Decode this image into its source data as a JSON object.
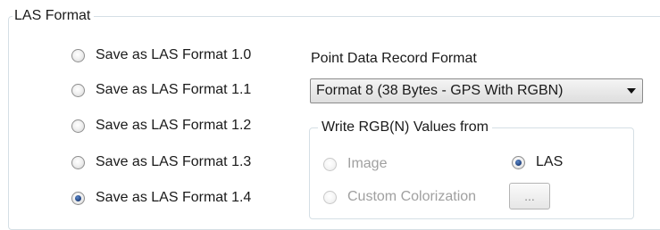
{
  "group": {
    "title": "LAS Format"
  },
  "las_versions": [
    {
      "label": "Save as LAS Format 1.0",
      "checked": false
    },
    {
      "label": "Save as LAS Format 1.1",
      "checked": false
    },
    {
      "label": "Save as LAS Format 1.2",
      "checked": false
    },
    {
      "label": "Save as LAS Format 1.3",
      "checked": false
    },
    {
      "label": "Save as LAS Format 1.4",
      "checked": true
    }
  ],
  "point_data_record_format": {
    "label": "Point Data Record Format",
    "selected": "Format 8 (38 Bytes - GPS With RGBN)"
  },
  "rgb_source": {
    "title": "Write RGB(N) Values from",
    "options": [
      {
        "label": "Image",
        "checked": false,
        "enabled": false
      },
      {
        "label": "LAS",
        "checked": true,
        "enabled": true
      },
      {
        "label": "Custom Colorization",
        "checked": false,
        "enabled": false
      }
    ],
    "browse_label": "..."
  },
  "colors": {
    "group_border": "#d5dfe5",
    "disabled_text": "#a0a0a0",
    "radio_dot": "#1f3f7a"
  }
}
